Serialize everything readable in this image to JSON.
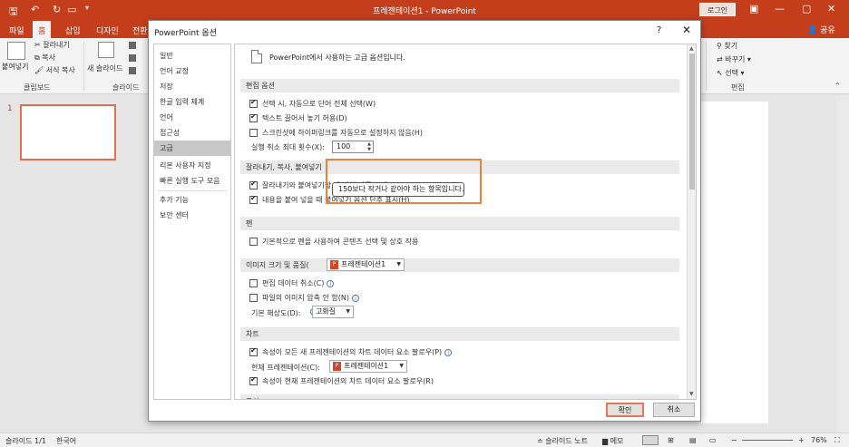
{
  "titlebar": {
    "doc_title": "프레젠테이션1  -  PowerPoint",
    "login": "로그인"
  },
  "tabs": [
    "파일",
    "홈",
    "삽입",
    "디자인",
    "전환"
  ],
  "share": "공유",
  "ribbon": {
    "paste": "붙여넣기",
    "cut": "잘라내기",
    "copy": "복사",
    "format_painter": "서식 복사",
    "clipboard_group": "클립보드",
    "new_slide": "새 슬라이드",
    "slides_group": "슬라이드",
    "find": "찾기",
    "replace": "바꾸기",
    "select": "선택",
    "edit_group": "편집"
  },
  "slides": {
    "number": "1"
  },
  "status": {
    "slide_count": "슬라이드 1/1",
    "language": "한국어",
    "notes": "슬라이드 노트",
    "comments": "메모",
    "zoom": "76%"
  },
  "dialog": {
    "title": "PowerPoint 옵션",
    "help": "?",
    "close": "✕",
    "nav": [
      "일반",
      "언어 교정",
      "저장",
      "한글 입력 체계",
      "언어",
      "접근성",
      "고급",
      "리본 사용자 지정",
      "빠른 실행 도구 모음",
      "추가 기능",
      "보안 센터"
    ],
    "intro": "PowerPoint에서 사용하는 고급 옵션입니다.",
    "sections": {
      "edit": "편집 옵션",
      "cutcopy": "잘라내기, 복사, 붙여넣기",
      "pen": "펜",
      "image": "이미지 크기 및 품질(",
      "chart": "차트",
      "display": "표시"
    },
    "edit_options": [
      {
        "label": "선택 시, 자동으로 단어 전체 선택(W)",
        "checked": true
      },
      {
        "label": "텍스트 끌어서 놓기 허용(D)",
        "checked": true
      },
      {
        "label": "스크린샷에 하이퍼링크를 자동으로 설정하지 않음(H)",
        "checked": false
      }
    ],
    "undo_label": "실행 취소 최대 횟수(X):",
    "undo_value": "100",
    "tooltip": "150보다 작거나 같아야 하는 항목입니다.",
    "cutcopy_options": [
      {
        "label": "잘라내기와 붙여넣기할 때 서식 자동 조정(S)",
        "checked": true
      },
      {
        "label": "내용을 붙여 넣을 때 붙여넣기 옵션 단추 표시(H)",
        "checked": true
      }
    ],
    "pen_options": [
      {
        "label": "기본적으로 펜을 사용하여 콘텐츠 선택 및 상호 작용",
        "checked": false
      }
    ],
    "image_doc": "프레젠테이션1",
    "image_options": [
      {
        "label": "편집 데이터 취소(C)",
        "checked": false
      },
      {
        "label": "파일의 이미지 압축 안 함(N)",
        "checked": false
      }
    ],
    "resolution_label": "기본 해상도(D):",
    "resolution_value": "고화질",
    "chart_option1": "속성이 모든 새 프레젠테이션의 차트 데이터 요소 팔로우(P)",
    "chart_current_label": "현재 프레젠테이션(C):",
    "chart_current_value": "프레젠테이션1",
    "chart_option2": "속성이 현재 프레젠테이션의 차트 데이터 요소 팔로우(R)",
    "ok": "확인",
    "cancel": "취소"
  }
}
